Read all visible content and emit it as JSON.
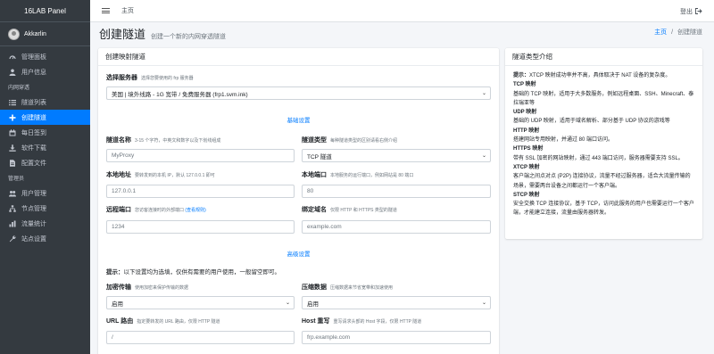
{
  "brand": "16LAB Panel",
  "user": {
    "name": "Akkarlin"
  },
  "sidebar": {
    "top_items": [
      {
        "label": "管理面板",
        "icon": "dashboard-icon"
      },
      {
        "label": "用户信息",
        "icon": "user-icon"
      }
    ],
    "header_proxy": "内网穿透",
    "proxy_items": [
      {
        "label": "隧道列表",
        "icon": "list-icon"
      },
      {
        "label": "创建隧道",
        "icon": "plus-icon",
        "active": true
      },
      {
        "label": "每日签到",
        "icon": "calendar-icon"
      },
      {
        "label": "软件下载",
        "icon": "download-icon"
      },
      {
        "label": "配置文件",
        "icon": "file-icon"
      }
    ],
    "header_admin": "管理员",
    "admin_items": [
      {
        "label": "用户管理",
        "icon": "users-icon"
      },
      {
        "label": "节点管理",
        "icon": "sitemap-icon"
      },
      {
        "label": "流量统计",
        "icon": "chart-icon"
      },
      {
        "label": "站点设置",
        "icon": "wrench-icon"
      }
    ]
  },
  "topbar": {
    "home": "主页",
    "logout": "登出"
  },
  "page": {
    "title": "创建隧道",
    "subtitle": "创建一个新的内网穿透隧道"
  },
  "breadcrumb": {
    "home": "主页",
    "sep": "/",
    "current": "创建隧道"
  },
  "form": {
    "card_title": "创建映射隧道",
    "server": {
      "label": "选择服务器",
      "hint": "选择您要使用的 frp 服务器",
      "value": "美国 | 境外线路 - 1G 宽带 / 免费服务器 (frp1.svm.ink)"
    },
    "basic_section": "基础设置",
    "name": {
      "label": "隧道名称",
      "hint": "3-15 个字符，中英文和数字以及下划线组成",
      "placeholder": "MyProxy"
    },
    "type": {
      "label": "隧道类型",
      "hint": "每种隧道类型的区别请看右侧介绍",
      "value": "TCP 隧道"
    },
    "local_ip": {
      "label": "本地地址",
      "hint": "要转发到的本机 IP，默认 127.0.0.1 即可",
      "value": "127.0.0.1"
    },
    "local_port": {
      "label": "本地端口",
      "hint": "本地服务的运行端口，例如网站是 80 端口",
      "value": "80"
    },
    "remote_port": {
      "label": "远程端口",
      "hint": "您访客连接时的外部端口",
      "link": "(查看规则)",
      "value": "1234"
    },
    "domain": {
      "label": "绑定域名",
      "hint": "仅限 HTTP 和 HTTPS 类型的隧道",
      "placeholder": "example.com"
    },
    "advanced_section": "高级设置",
    "tip_prefix": "提示：",
    "tip_text": "以下设置均为选填，仅供有需要的用户使用，一般留空即可。",
    "encrypt": {
      "label": "加密传输",
      "hint": "使用加密来保护传输的数据",
      "value": "启用"
    },
    "compress": {
      "label": "压缩数据",
      "hint": "压缩数据来节省宽带和加速使用",
      "value": "启用"
    },
    "url_route": {
      "label": "URL 路由",
      "hint": "指定要转发的 URL 路由，仅限 HTTP 隧道",
      "placeholder": "/"
    },
    "host_rewrite": {
      "label": "Host 重写",
      "hint": "重写请求头部的 Host 字段，仅限 HTTP 隧道",
      "placeholder": "frp.example.com"
    }
  },
  "info": {
    "title": "隧道类型介绍",
    "tip_prefix": "提示：",
    "tip_text": "XTCP 映射成功率并不高，具体取决于 NAT 设备的复杂度。",
    "tcp_h": "TCP 映射",
    "tcp_t": "基础的 TCP 映射，适用于大多数服务，例如远程桌面、SSH、Minecraft、泰拉瑞亚等",
    "udp_h": "UDP 映射",
    "udp_t": "基础的 UDP 映射，适用于域名解析、部分基于 UDP 协议的游戏等",
    "http_h": "HTTP 映射",
    "http_t": "搭建网站专用映射，并通过 80 端口访问。",
    "https_h": "HTTPS 映射",
    "https_t": "带有 SSL 加密的网站映射，通过 443 端口访问，服务器需要支持 SSL。",
    "xtcp_h": "XTCP 映射",
    "xtcp_t": "客户端之间点对点 (P2P) 连接协议，流量不经过服务器，适合大流量传输的场景，需要两台设备之间都运行一个客户端。",
    "stcp_h": "STCP 映射",
    "stcp_t": "安全交换 TCP 连接协议，基于 TCP，访问此服务的用户也需要运行一个客户端，才能建立连接，流量由服务器转发。"
  }
}
